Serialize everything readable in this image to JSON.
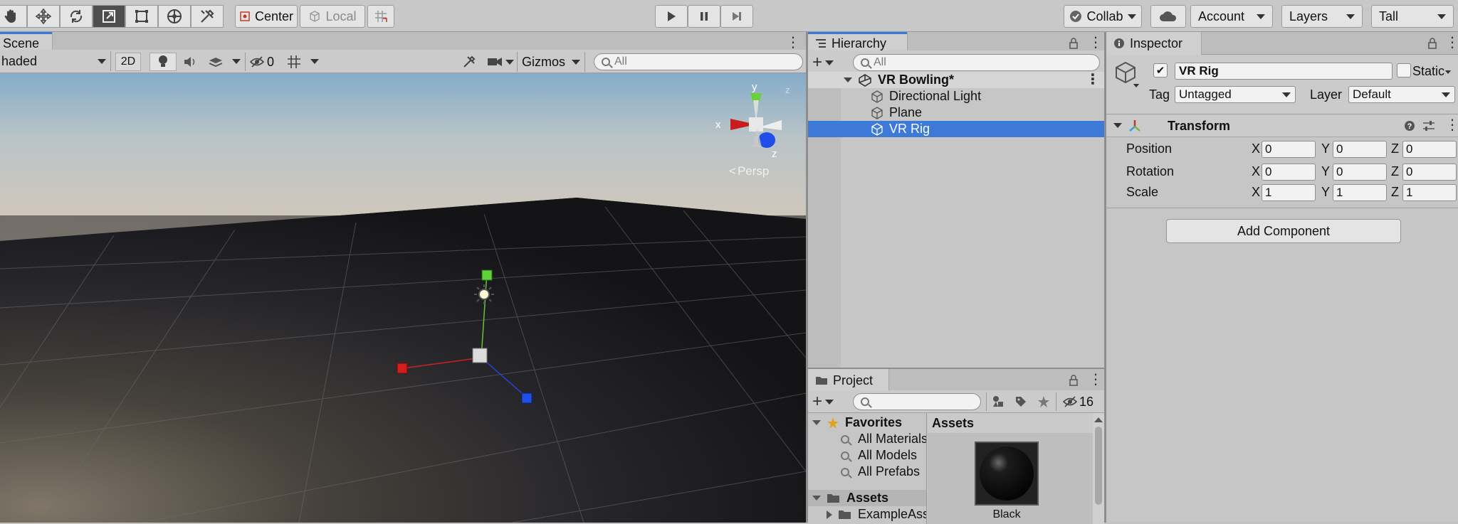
{
  "toolbar": {
    "tools": [
      "hand-tool",
      "move-tool",
      "rotate-tool",
      "scale-tool",
      "rect-tool",
      "transform-tool",
      "custom-tool"
    ],
    "pivot_label": "Center",
    "space_label": "Local",
    "collab_label": "Collab",
    "account_label": "Account",
    "layers_label": "Layers",
    "layout_label": "Tall"
  },
  "scene": {
    "tab_label": "Scene",
    "shading_mode": "haded",
    "mode_2d": "2D",
    "hidden_count": "0",
    "gizmos_label": "Gizmos",
    "search_placeholder": "All",
    "persp_label": "Persp",
    "axis_labels": {
      "x": "x",
      "y": "y",
      "z": "z"
    }
  },
  "hierarchy": {
    "tab_label": "Hierarchy",
    "search_placeholder": "All",
    "scene_name": "VR Bowling*",
    "items": [
      {
        "label": "Directional Light"
      },
      {
        "label": "Plane"
      },
      {
        "label": "VR Rig"
      }
    ]
  },
  "project": {
    "tab_label": "Project",
    "hidden_count": "16",
    "favorites_label": "Favorites",
    "favorites": [
      "All Materials",
      "All Models",
      "All Prefabs"
    ],
    "assets_label": "Assets",
    "assets_tree": [
      "ExampleAss"
    ],
    "assets_header": "Assets",
    "asset_items": [
      {
        "label": "Black"
      }
    ]
  },
  "inspector": {
    "tab_label": "Inspector",
    "object_name": "VR Rig",
    "static_label": "Static",
    "tag_label": "Tag",
    "tag_value": "Untagged",
    "layer_label": "Layer",
    "layer_value": "Default",
    "component_title": "Transform",
    "rows": [
      {
        "label": "Position",
        "x": "0",
        "y": "0",
        "z": "0"
      },
      {
        "label": "Rotation",
        "x": "0",
        "y": "0",
        "z": "0"
      },
      {
        "label": "Scale",
        "x": "1",
        "y": "1",
        "z": "1"
      }
    ],
    "axis": {
      "x": "X",
      "y": "Y",
      "z": "Z"
    },
    "add_component_label": "Add Component"
  },
  "colors": {
    "selection": "#3d79d6",
    "accent_tab": "#3a78d6",
    "x_axis": "#d3201d",
    "y_axis": "#73d33a",
    "z_axis": "#1f4fe8"
  }
}
